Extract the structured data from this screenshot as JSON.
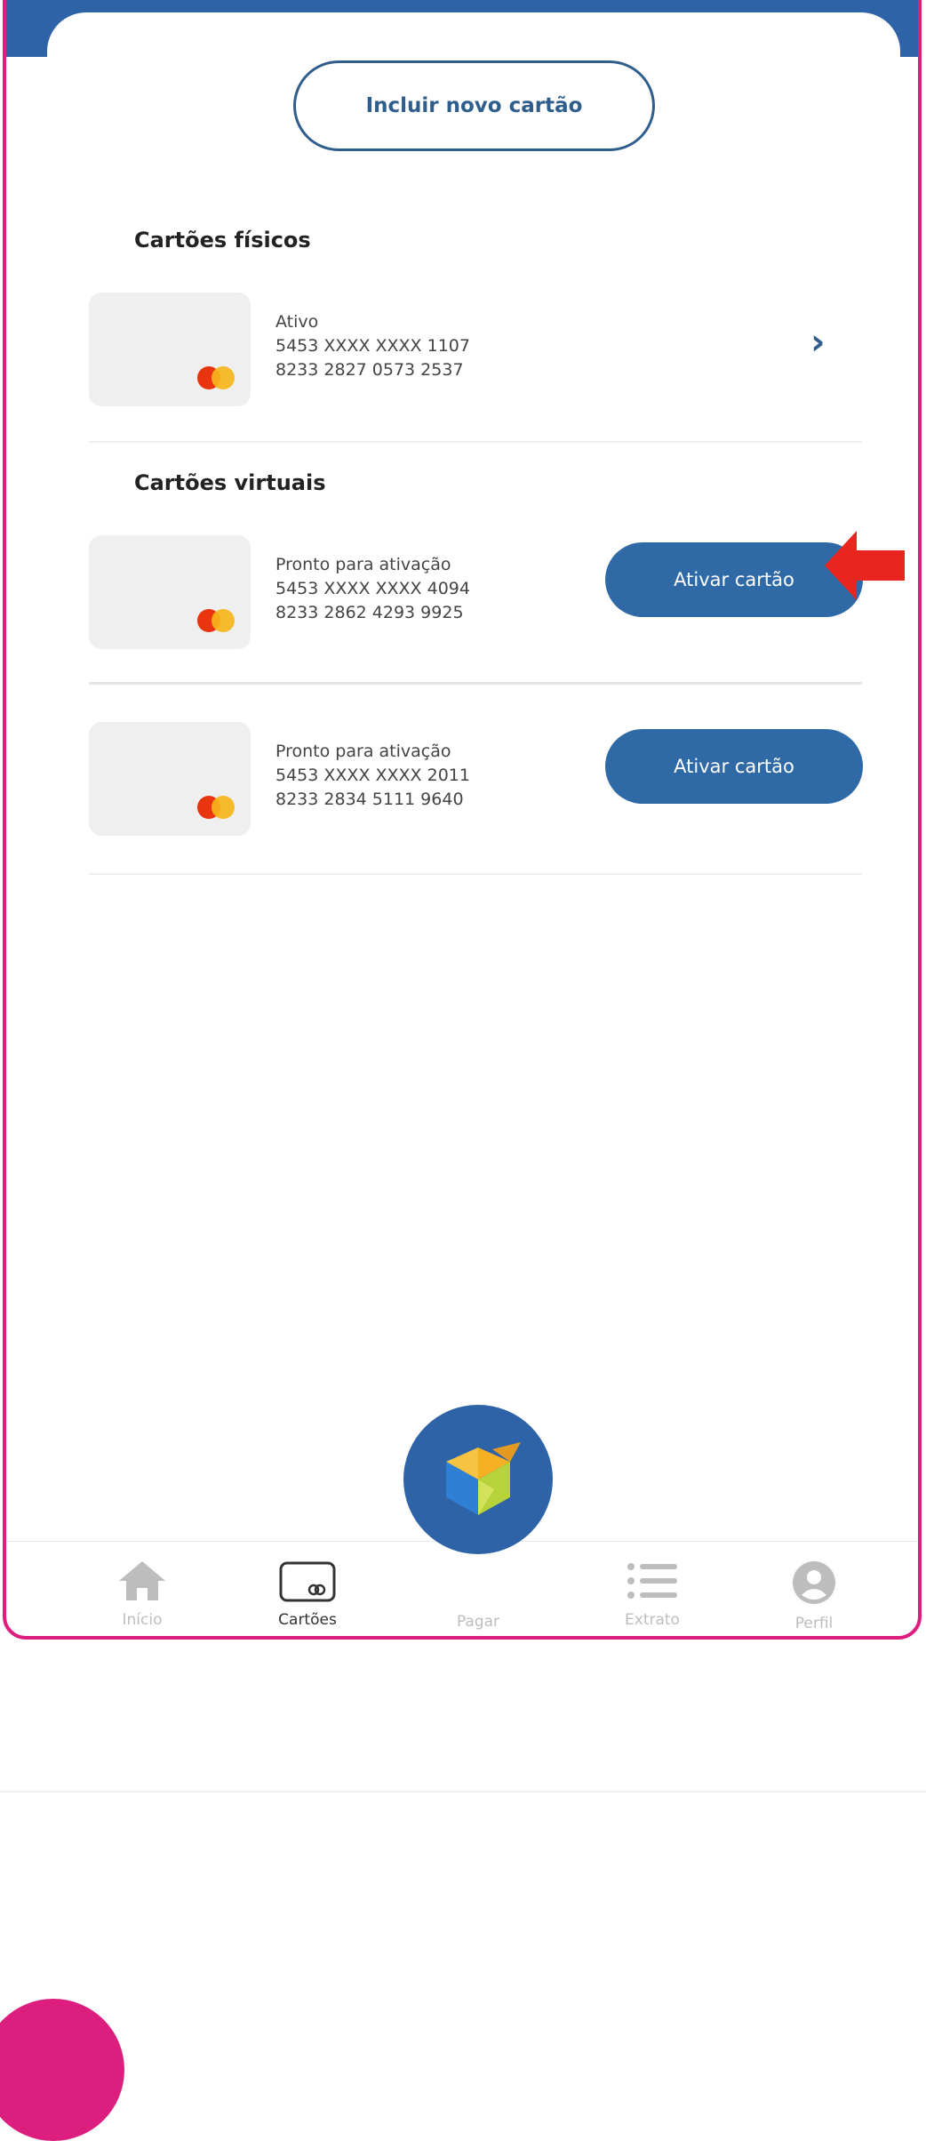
{
  "add_card_label": "Incluir novo cartão",
  "physical": {
    "title": "Cartões físicos",
    "cards": [
      {
        "status": "Ativo",
        "number": "5453 XXXX XXXX 1107",
        "code": "8233 2827 0573 2537"
      }
    ]
  },
  "virtual": {
    "title": "Cartões virtuais",
    "cards": [
      {
        "status": "Pronto para ativação",
        "number": "5453 XXXX XXXX 4094",
        "code": "8233 2862 4293 9925",
        "action": "Ativar cartão"
      },
      {
        "status": "Pronto para ativação",
        "number": "5453 XXXX XXXX 2011",
        "code": "8233 2834 5111 9640",
        "action": "Ativar cartão"
      }
    ]
  },
  "nav": {
    "items": [
      {
        "label": "Início",
        "icon": "home-icon"
      },
      {
        "label": "Cartões",
        "icon": "card-icon",
        "active": true
      },
      {
        "label": "Pagar",
        "icon": "pay-icon"
      },
      {
        "label": "Extrato",
        "icon": "list-icon"
      },
      {
        "label": "Perfil",
        "icon": "profile-icon"
      }
    ]
  },
  "colors": {
    "brand_blue": "#2f63a8",
    "frame_pink": "#dc1f7e",
    "arrow_red": "#e8261f",
    "mastercard_red": "#e8350f",
    "mastercard_yellow": "#f6b51c"
  }
}
